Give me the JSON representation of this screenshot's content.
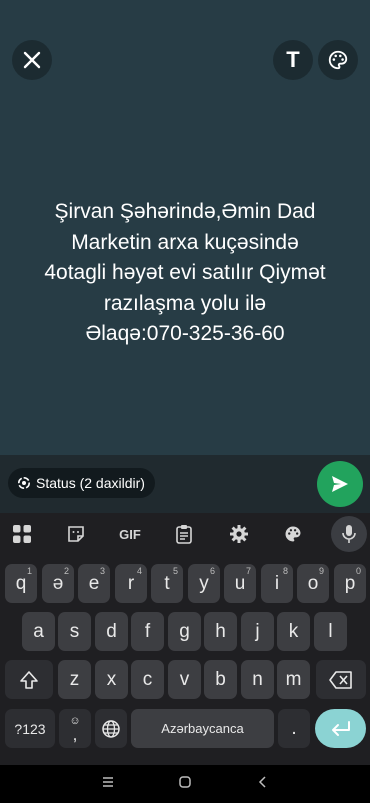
{
  "status": {
    "text": "Şirvan Şəhərində,Əmin Dad\nMarketin arxa  kuçəsində\n4otagli həyət evi satılır  Qiymət\nrazılaşma yolu ilə\nƏlaqə:070-325-36-60",
    "audience_label": "Status (2 daxildir)",
    "text_tool_label": "T"
  },
  "keyboard": {
    "toolbar_gif_label": "GIF",
    "row1": [
      {
        "k": "q",
        "s": "1"
      },
      {
        "k": "ə",
        "s": "2"
      },
      {
        "k": "e",
        "s": "3"
      },
      {
        "k": "r",
        "s": "4"
      },
      {
        "k": "t",
        "s": "5"
      },
      {
        "k": "y",
        "s": "6"
      },
      {
        "k": "u",
        "s": "7"
      },
      {
        "k": "i",
        "s": "8"
      },
      {
        "k": "o",
        "s": "9"
      },
      {
        "k": "p",
        "s": "0"
      }
    ],
    "row2": [
      "a",
      "s",
      "d",
      "f",
      "g",
      "h",
      "j",
      "k",
      "l"
    ],
    "row3": [
      "z",
      "x",
      "c",
      "v",
      "b",
      "n",
      "m"
    ],
    "symbols_label": "?123",
    "comma_label": ",",
    "space_label": "Azərbaycanca",
    "period_label": "."
  },
  "colors": {
    "background": "#273c45",
    "send_button": "#22a35d",
    "enter_key": "#8bd3d3"
  }
}
